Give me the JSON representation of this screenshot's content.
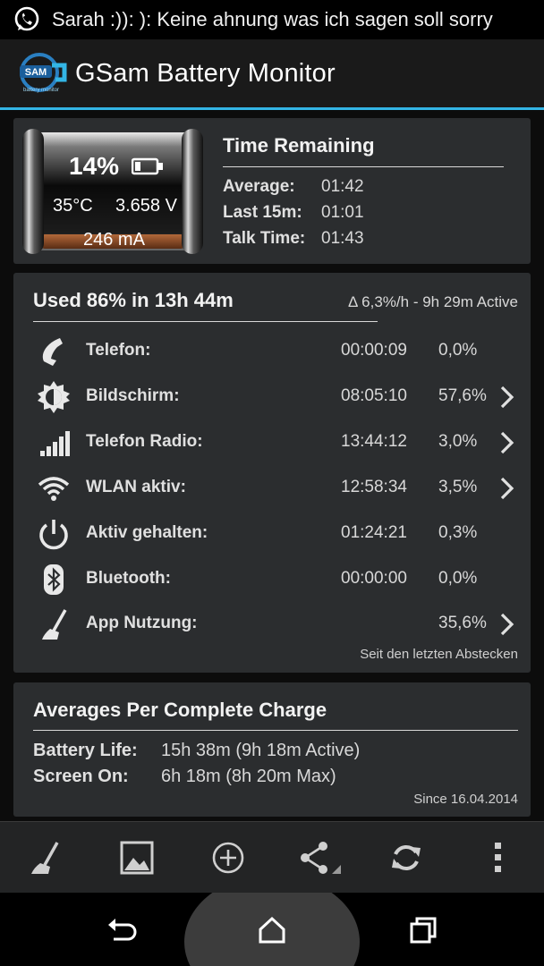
{
  "status_bar": {
    "notification_icon": "whatsapp-icon",
    "notification_text": "Sarah :)): ): Keine ahnung was ich sagen soll sorry"
  },
  "app": {
    "title": "GSam Battery Monitor",
    "logo_text": "SAM",
    "logo_subtext": "battery monitor",
    "accent_color": "#33b5e5"
  },
  "battery": {
    "percent": "14%",
    "level": 0.14,
    "temperature": "35°C",
    "voltage": "3.658 V",
    "current": "246 mA"
  },
  "time_remaining": {
    "title": "Time Remaining",
    "rows": [
      {
        "label": "Average:",
        "value": "01:42"
      },
      {
        "label": "Last 15m:",
        "value": "01:01"
      },
      {
        "label": "Talk Time:",
        "value": "01:43"
      }
    ]
  },
  "usage": {
    "title": "Used 86% in 13h 44m",
    "rate": "Δ 6,3%/h - 9h 29m Active",
    "rows": [
      {
        "icon": "phone-icon",
        "label": "Telefon:",
        "time": "00:00:09",
        "percent": "0,0%",
        "has_chevron": false
      },
      {
        "icon": "screen-brightness-icon",
        "label": "Bildschirm:",
        "time": "08:05:10",
        "percent": "57,6%",
        "has_chevron": true
      },
      {
        "icon": "signal-bars-icon",
        "label": "Telefon Radio:",
        "time": "13:44:12",
        "percent": "3,0%",
        "has_chevron": true
      },
      {
        "icon": "wifi-icon",
        "label": "WLAN aktiv:",
        "time": "12:58:34",
        "percent": "3,5%",
        "has_chevron": true
      },
      {
        "icon": "power-icon",
        "label": "Aktiv gehalten:",
        "time": "01:24:21",
        "percent": "0,3%",
        "has_chevron": false
      },
      {
        "icon": "bluetooth-icon",
        "label": "Bluetooth:",
        "time": "00:00:00",
        "percent": "0,0%",
        "has_chevron": false
      },
      {
        "icon": "broom-icon",
        "label": "App Nutzung:",
        "time": "",
        "percent": "35,6%",
        "has_chevron": true
      }
    ],
    "footer": "Seit den letzten Abstecken"
  },
  "averages": {
    "title": "Averages Per Complete Charge",
    "rows": [
      {
        "label": "Battery Life:",
        "value": "15h 38m (9h 18m Active)"
      },
      {
        "label": "Screen On:",
        "value": "6h 18m (8h 20m Max)"
      }
    ],
    "footer": "Since 16.04.2014"
  },
  "toolbar": {
    "buttons": [
      "broom-icon",
      "image-icon",
      "add-circle-icon",
      "share-icon",
      "refresh-icon",
      "overflow-menu-icon"
    ]
  },
  "nav": {
    "buttons": [
      "back-icon",
      "home-icon",
      "recents-icon"
    ]
  }
}
